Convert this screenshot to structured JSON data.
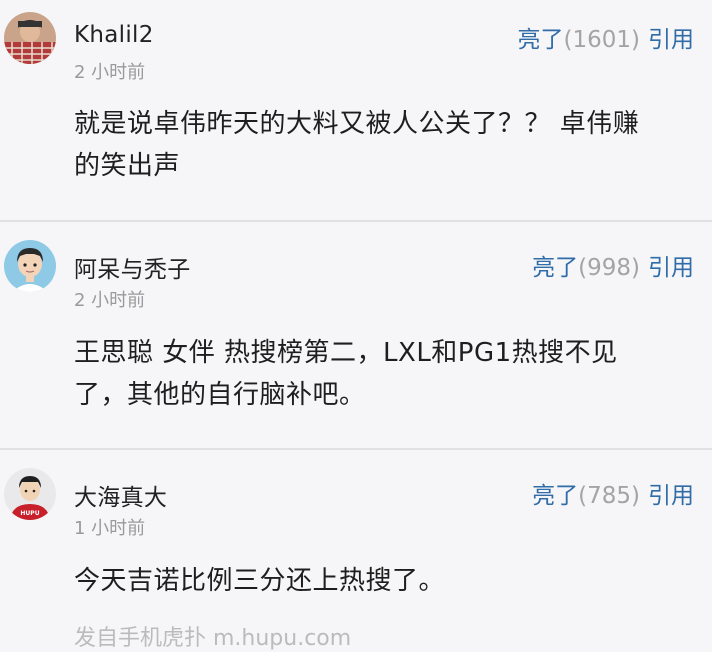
{
  "comments": [
    {
      "username": "Khalil2",
      "time": "2 小时前",
      "like_label": "亮了",
      "like_count": "(1601)",
      "quote_label": "引用",
      "content_lines": [
        "就是说卓伟昨天的大料又被人公关了？？ 卓伟赚",
        "的笑出声"
      ]
    },
    {
      "username": "阿呆与秃子",
      "time": "2 小时前",
      "like_label": "亮了",
      "like_count": "(998)",
      "quote_label": "引用",
      "content_lines": [
        "王思聪 女伴 热搜榜第二，LXL和PG1热搜不见",
        "了，其他的自行脑补吧。"
      ]
    },
    {
      "username": "大海真大",
      "time": "1 小时前",
      "like_label": "亮了",
      "like_count": "(785)",
      "quote_label": "引用",
      "content_lines": [
        "今天吉诺比例三分还上热搜了。"
      ],
      "avatar_text": "HUPU"
    }
  ],
  "source_text": "发自手机虎扑 m.hupu.com",
  "colors": {
    "link": "#2f6ca8",
    "muted": "#9a9a9a",
    "background": "#f6f6f8"
  }
}
